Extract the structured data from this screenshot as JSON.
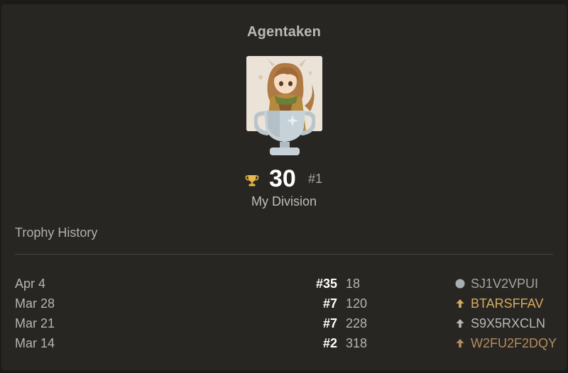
{
  "player": {
    "username": "Agentaken",
    "trophies": "30",
    "rank": "#1",
    "division": "My Division"
  },
  "history": {
    "title": "Trophy History",
    "rows": [
      {
        "date": "Apr 4",
        "place": "#35",
        "trophies": "18",
        "status_icon": "circle-icon",
        "code": "SJ1V2VPUI",
        "code_color": "#a9a6a2",
        "icon_color": "#a9aeb0"
      },
      {
        "date": "Mar 28",
        "place": "#7",
        "trophies": "120",
        "status_icon": "arrow-up-icon",
        "code": "BTARSFFAV",
        "code_color": "#d8aa63",
        "icon_color": "#d8aa63"
      },
      {
        "date": "Mar 21",
        "place": "#7",
        "trophies": "228",
        "status_icon": "arrow-up-icon",
        "code": "S9X5RXCLN",
        "code_color": "#b6b9bb",
        "icon_color": "#b6b9bb"
      },
      {
        "date": "Mar 14",
        "place": "#2",
        "trophies": "318",
        "status_icon": "arrow-up-icon",
        "code": "W2FU2F2DQY",
        "code_color": "#b68d5e",
        "icon_color": "#b68d5e"
      }
    ]
  },
  "colors": {
    "background": "#282622",
    "gold": "#e8b84a",
    "silver_trophy": "#c9d4da"
  }
}
